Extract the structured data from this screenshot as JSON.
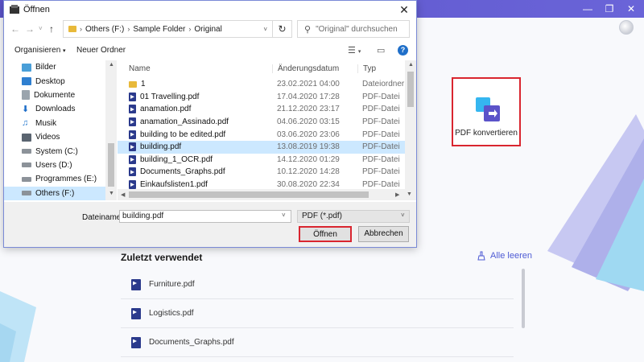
{
  "app": {
    "convert_label": "PDF konvertieren",
    "recent_title": "Zuletzt verwendet",
    "clear_all": "Alle leeren",
    "recent_files": [
      "Furniture.pdf",
      "Logistics.pdf",
      "Documents_Graphs.pdf"
    ],
    "colors": {
      "accent": "#5b53c9",
      "highlight": "#d9252f",
      "link": "#4e5bd4"
    }
  },
  "dialog": {
    "title": "Öffnen",
    "breadcrumb": [
      "Others (F:)",
      "Sample Folder",
      "Original"
    ],
    "search_placeholder": "\"Original\" durchsuchen",
    "toolbar": {
      "organize": "Organisieren",
      "new_folder": "Neuer Ordner"
    },
    "nav_items": [
      {
        "label": "Bilder",
        "icon": "pictures-icon"
      },
      {
        "label": "Desktop",
        "icon": "desktop-icon"
      },
      {
        "label": "Dokumente",
        "icon": "documents-icon"
      },
      {
        "label": "Downloads",
        "icon": "downloads-icon"
      },
      {
        "label": "Musik",
        "icon": "music-icon"
      },
      {
        "label": "Videos",
        "icon": "videos-icon"
      },
      {
        "label": "System (C:)",
        "icon": "drive-icon"
      },
      {
        "label": "Users (D:)",
        "icon": "drive-icon"
      },
      {
        "label": "Programmes (E:)",
        "icon": "drive-icon"
      },
      {
        "label": "Others (F:)",
        "icon": "drive-icon"
      }
    ],
    "columns": {
      "name": "Name",
      "date": "Änderungsdatum",
      "type": "Typ"
    },
    "files": [
      {
        "name": "1",
        "date": "23.02.2021 04:00",
        "type": "Dateiordner",
        "kind": "folder"
      },
      {
        "name": "01 Travelling.pdf",
        "date": "17.04.2020 17:28",
        "type": "PDF-Datei",
        "kind": "pdf"
      },
      {
        "name": "anamation.pdf",
        "date": "21.12.2020 23:17",
        "type": "PDF-Datei",
        "kind": "pdf"
      },
      {
        "name": "anamation_Assinado.pdf",
        "date": "04.06.2020 03:15",
        "type": "PDF-Datei",
        "kind": "pdf"
      },
      {
        "name": "building to be edited.pdf",
        "date": "03.06.2020 23:06",
        "type": "PDF-Datei",
        "kind": "pdf"
      },
      {
        "name": "building.pdf",
        "date": "13.08.2019 19:38",
        "type": "PDF-Datei",
        "kind": "pdf"
      },
      {
        "name": "building_1_OCR.pdf",
        "date": "14.12.2020 01:29",
        "type": "PDF-Datei",
        "kind": "pdf"
      },
      {
        "name": "Documents_Graphs.pdf",
        "date": "10.12.2020 14:28",
        "type": "PDF-Datei",
        "kind": "pdf"
      },
      {
        "name": "Einkaufslisten1.pdf",
        "date": "30.08.2020 22:34",
        "type": "PDF-Datei",
        "kind": "pdf"
      }
    ],
    "filename_label": "Dateiname:",
    "filename_value": "building.pdf",
    "filetype_value": "PDF (*.pdf)",
    "open_button": "Öffnen",
    "cancel_button": "Abbrechen"
  }
}
